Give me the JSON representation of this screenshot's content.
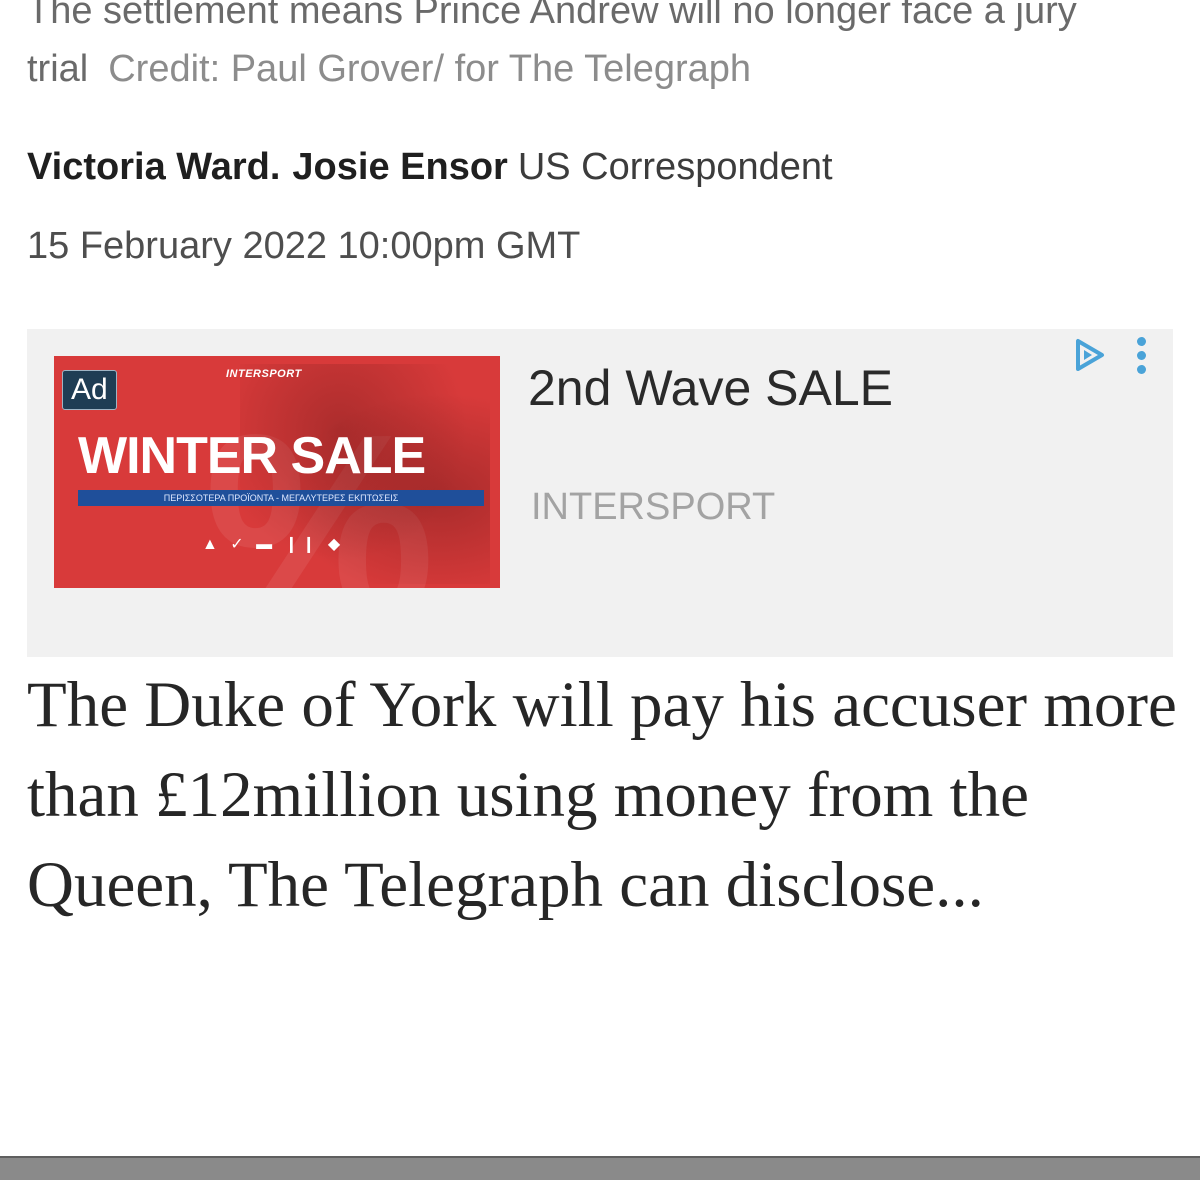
{
  "caption": {
    "text": "The settlement means Prince Andrew will no longer face a jury trial",
    "credit": "Credit: Paul Grover/ for The Telegraph"
  },
  "byline": {
    "author1": "Victoria Ward.",
    "author2": "Josie Ensor",
    "role": "US Correspondent"
  },
  "dateline": "15 February 2022 10:00pm GMT",
  "ad": {
    "badge": "Ad",
    "image_brand": "INTERSPORT",
    "image_headline": "WINTER SALE",
    "image_strip": "ΠΕΡΙΣΣΟΤΕΡΑ ΠΡΟΪΟΝΤΑ - ΜΕΓΑΛΥΤΕΡΕΣ ΕΚΠΤΩΣΕΙΣ",
    "title": "2nd Wave SALE",
    "advertiser": "INTERSPORT",
    "adchoices_icon": "adchoices-icon",
    "menu_icon": "kebab-menu-icon",
    "accent_color": "#4aa3d8",
    "image_color": "#d83a3a"
  },
  "article": {
    "lede": "The Duke of York will pay his accuser more than £12million using money from the Queen, The Telegraph can disclose..."
  }
}
